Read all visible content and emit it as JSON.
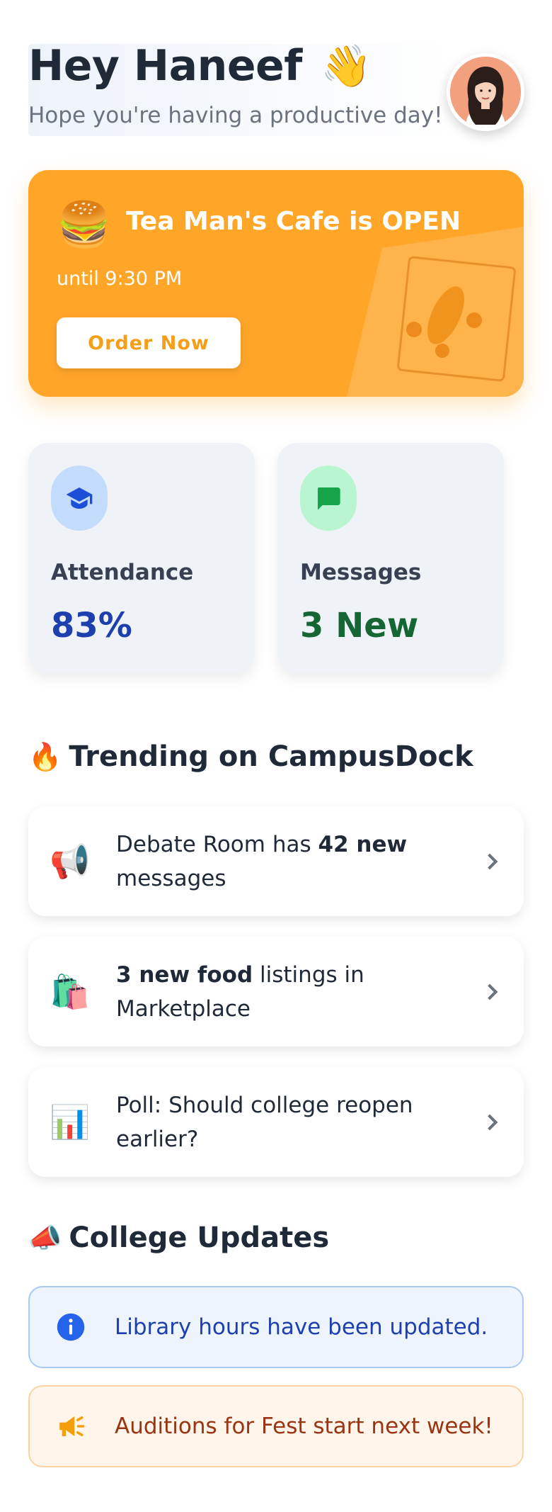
{
  "header": {
    "greeting": "Hey Haneef",
    "wave_emoji": "👋",
    "subtitle": "Hope you're having a productive day!",
    "avatar_icon": "woman-avatar"
  },
  "promo": {
    "icon": "🍔",
    "title": "Tea Man's Cafe is OPEN",
    "hours": "until 9:30 PM",
    "button_label": "Order Now",
    "color": "#ffa629"
  },
  "stats": [
    {
      "label": "Attendance",
      "value": "83%",
      "icon": "graduation-cap-icon",
      "accent": "#1e40af"
    },
    {
      "label": "Messages",
      "value": "3 New",
      "icon": "chat-bubble-icon",
      "accent": "#166534"
    }
  ],
  "trending": {
    "emoji": "🔥",
    "title": "Trending on CampusDock",
    "items": [
      {
        "icon": "📢",
        "pre": "Debate Room has ",
        "bold": "42 new",
        "post": " messages"
      },
      {
        "icon": "🛍️",
        "pre": "",
        "bold": "3 new food",
        "post": " listings in Marketplace"
      },
      {
        "icon": "📊",
        "pre": "Poll: Should college reopen earlier?",
        "bold": "",
        "post": ""
      }
    ]
  },
  "updates": {
    "emoji": "📣",
    "title": "College Updates",
    "items": [
      {
        "text": "Library hours have been updated.",
        "icon": "info-icon",
        "color": "#1e40af"
      },
      {
        "text": "Auditions for Fest start next week!",
        "icon": "megaphone-icon",
        "color": "#9a3412"
      }
    ]
  }
}
